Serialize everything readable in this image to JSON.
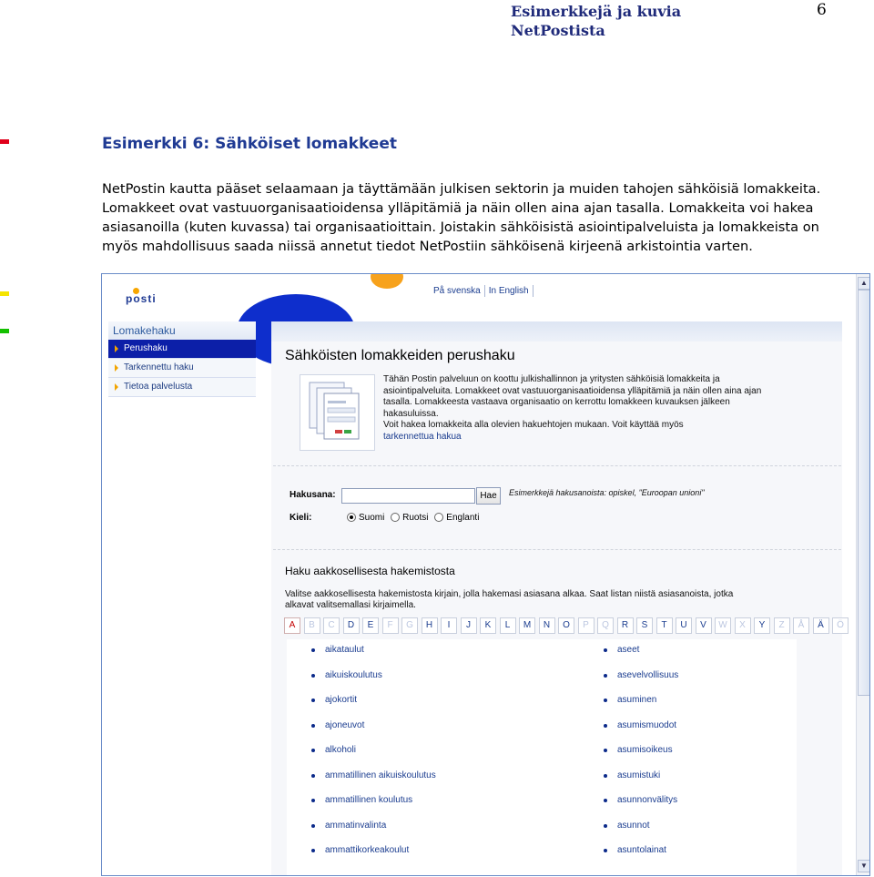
{
  "page_header": {
    "line1": "Esimerkkejä ja kuvia",
    "line2": "NetPostista",
    "page_number": "6"
  },
  "margin_marks": {
    "colors": [
      "#e0001b",
      "#f5e400",
      "#14c000"
    ]
  },
  "section_heading": "Esimerkki 6: Sähköiset lomakkeet",
  "body_lines": [
    "NetPostin kautta pääset selaamaan ja täyttämään julkisen sektorin ja muiden tahojen sähköisiä lomakkeita.",
    "Lomakkeet ovat vastuuorganisaatioidensa ylläpitämiä ja näin ollen aina ajan tasalla.  Lomakkeita voi hakea",
    "asiasanoilla (kuten kuvassa) tai organisaatioittain. Joistakin sähköisistä asiointipalveluista ja lomakkeista on",
    "myös mahdollisuus saada niissä annetut tiedot NetPostiin sähköisenä kirjeenä arkistointia varten."
  ],
  "screenshot": {
    "logo_text": "posti",
    "lang_links": [
      "På svenska",
      "In English"
    ],
    "sidebar": {
      "title": "Lomakehaku",
      "items": [
        "Perushaku",
        "Tarkennettu haku",
        "Tietoa palvelusta"
      ]
    },
    "main_title": "Sähköisten lomakkeiden perushaku",
    "intro_text": "Tähän Postin palveluun on koottu julkishallinnon ja yritysten sähköisiä lomakkeita ja asiointipalveluita. Lomakkeet ovat vastuuorganisaatioidensa ylläpitämiä ja näin ollen aina ajan tasalla. Lomakkeesta vastaava organisaatio on kerrottu lomakkeen kuvauksen jälkeen hakasuluissa.",
    "intro_text2": "Voit hakea lomakkeita alla olevien hakuehtojen mukaan. Voit käyttää myös",
    "intro_link": "tarkennettua hakua",
    "search_label": "Hakusana:",
    "search_value": "",
    "search_button": "Hae",
    "search_example": "Esimerkkejä hakusanoista: opiskel, \"Euroopan unioni\"",
    "language_label": "Kieli:",
    "languages": [
      "Suomi",
      "Ruotsi",
      "Englanti"
    ],
    "alpha_title": "Haku aakkosellisesta hakemistosta",
    "alpha_desc": "Valitse aakkosellisesta hakemistosta kirjain, jolla hakemasi asiasana alkaa. Saat listan niistä asiasanoista, jotka alkavat valitsemallasi kirjaimella.",
    "letters": [
      "A",
      "B",
      "C",
      "D",
      "E",
      "F",
      "G",
      "H",
      "I",
      "J",
      "K",
      "L",
      "M",
      "N",
      "O",
      "P",
      "Q",
      "R",
      "S",
      "T",
      "U",
      "V",
      "W",
      "X",
      "Y",
      "Z",
      "Å",
      "Ä",
      "Ö"
    ],
    "letters_disabled": [
      "B",
      "C",
      "F",
      "G",
      "P",
      "Q",
      "W",
      "X",
      "Z",
      "Å",
      "Ö"
    ],
    "active_letter": "A",
    "results_left": [
      "aikataulut",
      "aikuiskoulutus",
      "ajokortit",
      "ajoneuvot",
      "alkoholi",
      "ammatillinen aikuiskoulutus",
      "ammatillinen koulutus",
      "ammatinvalinta",
      "ammattikorkeakoulut"
    ],
    "results_right": [
      "aseet",
      "asevelvollisuus",
      "asuminen",
      "asumismuodot",
      "asumisoikeus",
      "asumistuki",
      "asunnonvälitys",
      "asunnot",
      "asuntolainat"
    ]
  }
}
